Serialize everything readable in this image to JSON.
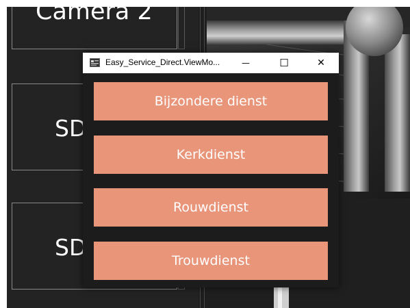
{
  "tiles": [
    {
      "label": "Camera 2"
    },
    {
      "label": "SD"
    },
    {
      "label": "SD"
    }
  ],
  "dialog": {
    "title": "Easy_Service_Direct.ViewMo...",
    "controls": {
      "minimize": "—",
      "maximize": "☐",
      "close": "✕"
    },
    "buttons": [
      {
        "label": "Bijzondere dienst"
      },
      {
        "label": "Kerkdienst"
      },
      {
        "label": "Rouwdienst"
      },
      {
        "label": "Trouwdienst"
      }
    ]
  },
  "colors": {
    "button": "#e8957a",
    "background": "#1e1e1e",
    "titlebar": "#ffffff"
  }
}
